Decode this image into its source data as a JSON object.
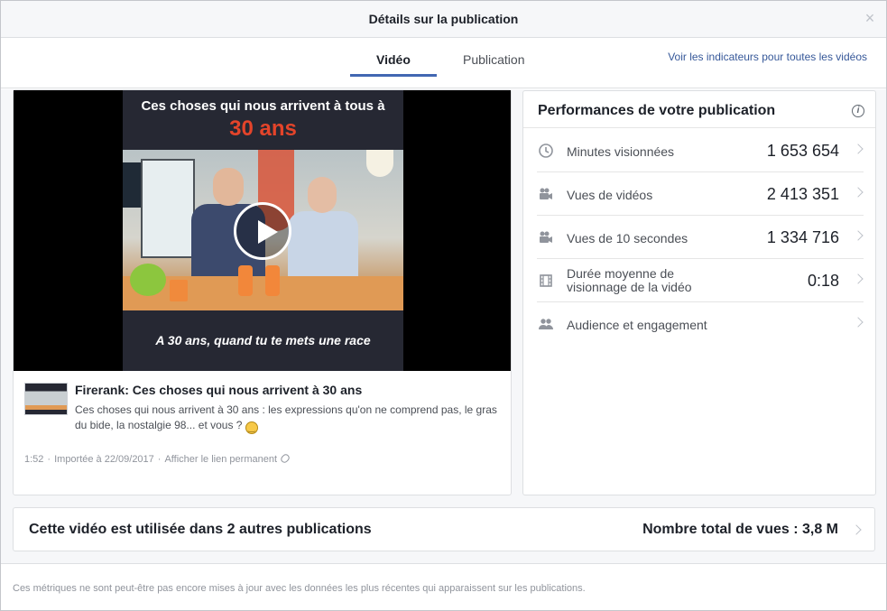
{
  "dialog": {
    "title": "Détails sur la publication",
    "close_symbol": "×"
  },
  "tabs": [
    {
      "label": "Vidéo",
      "active": true
    },
    {
      "label": "Publication",
      "active": false
    }
  ],
  "top_link": "Voir les indicateurs pour toutes les vidéos",
  "video": {
    "thumbnail": {
      "line1": "Ces choses qui nous arrivent à tous à",
      "line2": "30 ans",
      "caption": "A 30 ans, quand tu te mets une race"
    },
    "post_title": "Firerank: Ces choses qui nous arrivent à 30 ans",
    "post_description": "Ces choses qui nous arrivent à 30 ans : les expressions qu'on ne comprend pas, le gras du bide, la nostalgie 98... et vous ?",
    "duration": "1:52",
    "uploaded": "Importée à 22/09/2017",
    "permalink_label": "Afficher le lien permanent"
  },
  "performance": {
    "title": "Performances de votre publication",
    "metrics": [
      {
        "icon": "clock-icon",
        "label": "Minutes visionnées",
        "value": "1 653 654"
      },
      {
        "icon": "video-camera-icon",
        "label": "Vues de vidéos",
        "value": "2 413 351"
      },
      {
        "icon": "video-camera-icon",
        "label": "Vues de 10 secondes",
        "value": "1 334 716"
      },
      {
        "icon": "film-icon",
        "label_line1": "Durée moyenne de",
        "label_line2": "visionnage de la vidéo",
        "value": "0:18"
      },
      {
        "icon": "people-icon",
        "label": "Audience et engagement",
        "value": ""
      }
    ]
  },
  "usage": {
    "left": "Cette vidéo est utilisée dans 2 autres publications",
    "right": "Nombre total de vues : 3,8 M"
  },
  "footer_note": "Ces métriques ne sont peut-être pas encore mises à jour avec les données les plus récentes qui apparaissent sur les publications.",
  "colors": {
    "accent": "#4267b2",
    "link": "#365899",
    "thumbnail_highlight": "#e4442a"
  }
}
